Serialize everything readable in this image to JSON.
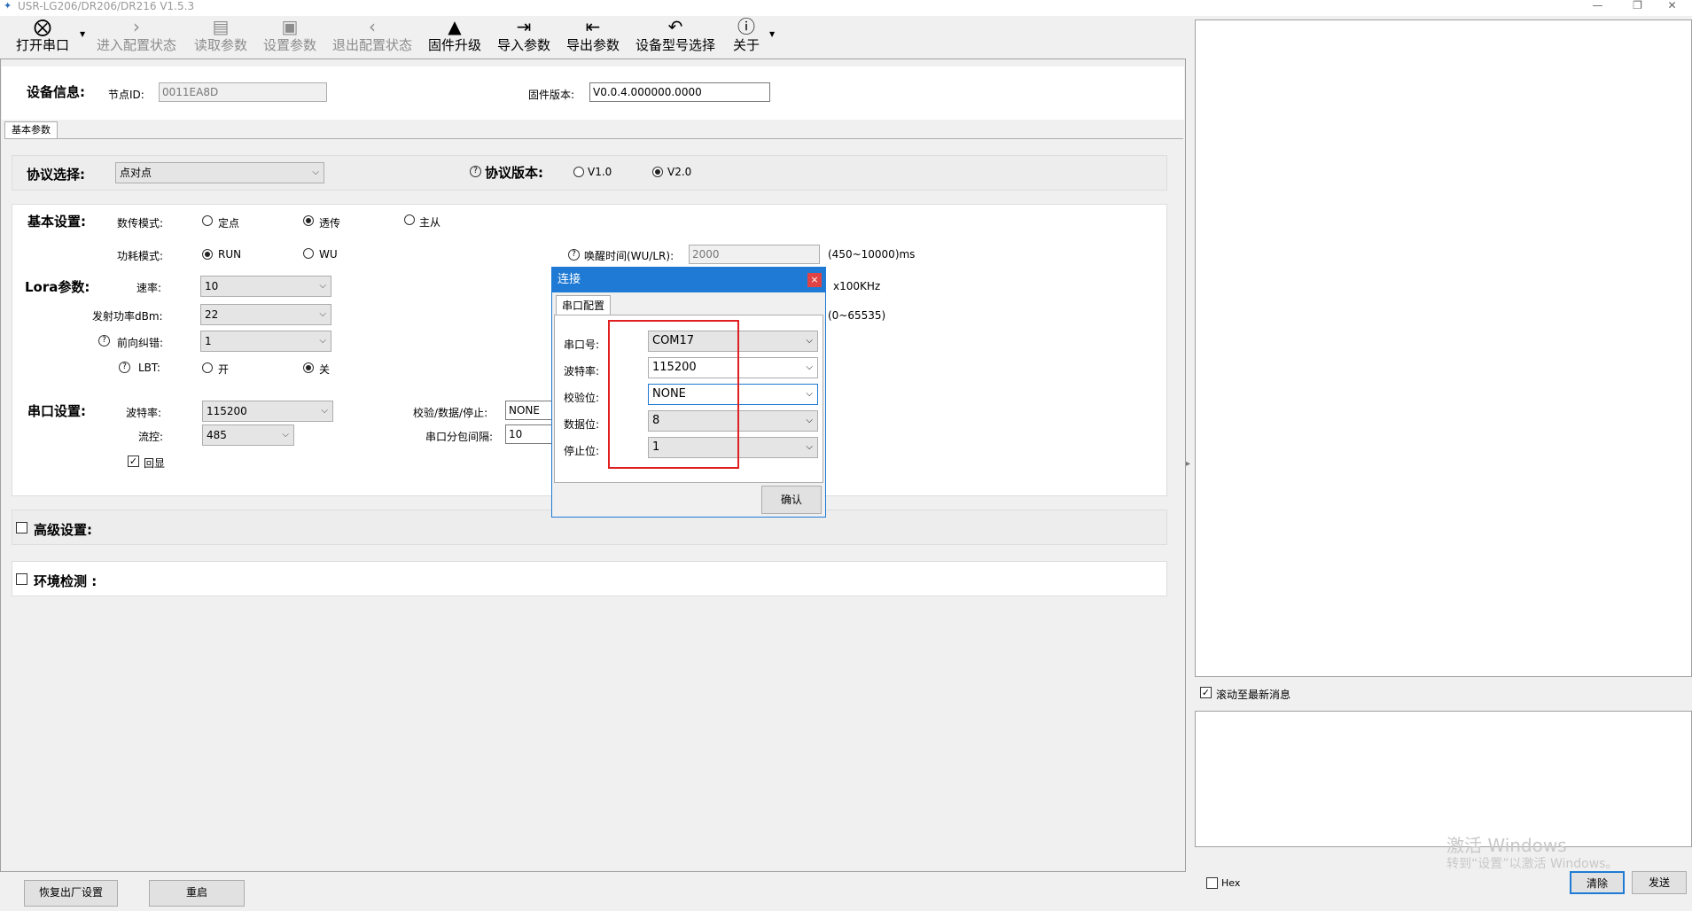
{
  "window": {
    "title": "USR-LG206/DR206/DR216 V1.5.3"
  },
  "toolbar": {
    "items": [
      {
        "label": "打开串口",
        "icon": "⨂"
      },
      {
        "label": "进入配置状态",
        "icon": "›"
      },
      {
        "label": "读取参数",
        "icon": "▤"
      },
      {
        "label": "设置参数",
        "icon": "▣"
      },
      {
        "label": "退出配置状态",
        "icon": "‹"
      },
      {
        "label": "固件升级",
        "icon": "▲"
      },
      {
        "label": "导入参数",
        "icon": "⇥"
      },
      {
        "label": "导出参数",
        "icon": "⇤"
      },
      {
        "label": "设备型号选择",
        "icon": "↶"
      },
      {
        "label": "关于",
        "icon": "ⓘ"
      }
    ]
  },
  "device_info": {
    "heading": "设备信息:",
    "node_id_label": "节点ID:",
    "node_id_value": "0011EA8D",
    "firmware_label": "固件版本:",
    "firmware_value": "V0.0.4.000000.0000"
  },
  "tab": {
    "label": "基本参数"
  },
  "protocol": {
    "heading": "协议选择:",
    "selected": "点对点",
    "version_label": "协议版本:",
    "v1": "V1.0",
    "v2": "V2.0"
  },
  "basic": {
    "heading": "基本设置:",
    "mode_label": "数传模式:",
    "mode_opt1": "定点",
    "mode_opt2": "透传",
    "mode_opt3": "主从",
    "power_label": "功耗模式:",
    "power_opt1": "RUN",
    "power_opt2": "WU",
    "wake_label": "唤醒时间(WU/LR):",
    "wake_value": "2000",
    "wake_unit": "(450~10000)ms",
    "freq_unit": "x100KHz",
    "range_unit": "(0~65535)"
  },
  "lora": {
    "heading": "Lora参数:",
    "rate_label": "速率:",
    "rate_value": "10",
    "txpower_label": "发射功率dBm:",
    "txpower_value": "22",
    "fec_label": "前向纠错:",
    "fec_value": "1",
    "lbt_label": "LBT:",
    "lbt_on": "开",
    "lbt_off": "关"
  },
  "serial": {
    "heading": "串口设置:",
    "baud_label": "波特率:",
    "baud_value": "115200",
    "flow_label": "流控:",
    "flow_value": "485",
    "echo_label": "回显",
    "parity_label": "校验/数据/停止:",
    "parity_value": "NONE",
    "interval_label": "串口分包间隔:",
    "interval_value": "10"
  },
  "advanced": {
    "heading": "高级设置:"
  },
  "env": {
    "heading": "环境检测 :"
  },
  "dialog": {
    "title": "连接",
    "tab": "串口配置",
    "port_label": "串口号:",
    "port_value": "COM17",
    "baud_label": "波特率:",
    "baud_value": "115200",
    "parity_label": "校验位:",
    "parity_value": "NONE",
    "data_label": "数据位:",
    "data_value": "8",
    "stop_label": "停止位:",
    "stop_value": "1",
    "ok": "确认"
  },
  "right": {
    "scroll_label": "滚动至最新消息",
    "hex_label": "Hex",
    "clear": "清除",
    "send": "发送"
  },
  "bottom": {
    "factory_reset": "恢复出厂设置",
    "restart": "重启"
  },
  "watermark": {
    "line1": "激活 Windows",
    "line2": "转到“设置”以激活 Windows。"
  },
  "colors": {
    "accent": "#1e7ad4",
    "highlight_box": "#e02020"
  }
}
